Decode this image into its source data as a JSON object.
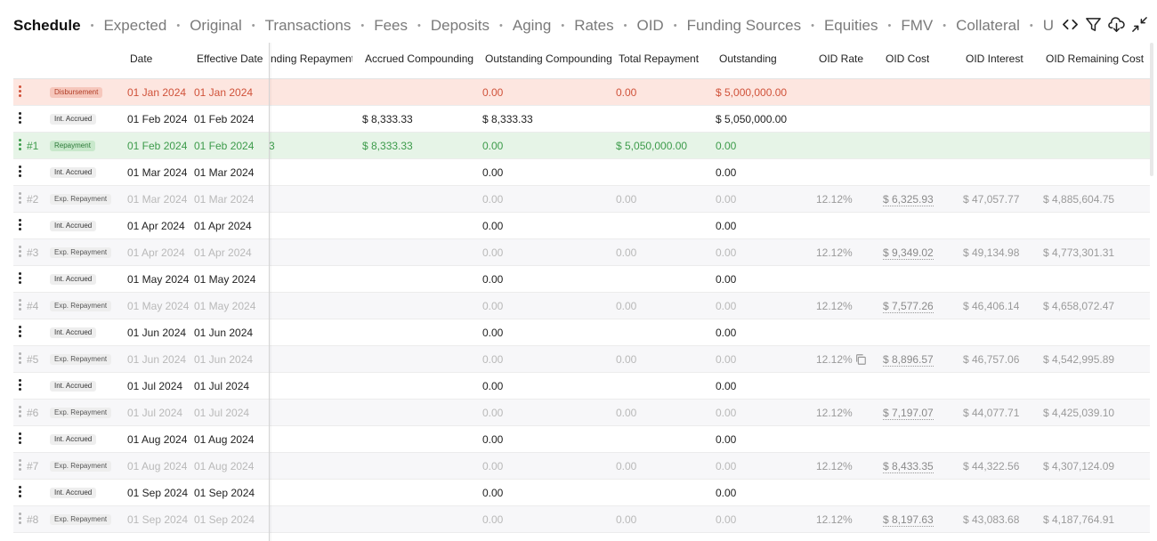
{
  "tabs": [
    {
      "label": "Schedule",
      "active": true
    },
    {
      "label": "Expected"
    },
    {
      "label": "Original"
    },
    {
      "label": "Transactions"
    },
    {
      "label": "Fees"
    },
    {
      "label": "Deposits"
    },
    {
      "label": "Aging"
    },
    {
      "label": "Rates"
    },
    {
      "label": "OID"
    },
    {
      "label": "Funding Sources"
    },
    {
      "label": "Equities"
    },
    {
      "label": "FMV"
    },
    {
      "label": "Collateral"
    },
    {
      "label": "U"
    }
  ],
  "separator": "•",
  "toolbar": {
    "icons": [
      "code-icon",
      "filter-icon",
      "cloud-download-icon",
      "collapse-icon"
    ]
  },
  "columns": {
    "date": "Date",
    "effective_date": "Effective Date",
    "funding_repayment": "nding Repayment",
    "accrued_compounding": "Accrued Compounding",
    "outstanding_compounding": "Outstanding Compounding",
    "total_repayment": "Total Repayment",
    "outstanding": "Outstanding",
    "oid_rate": "OID Rate",
    "oid_cost": "OID Cost",
    "oid_interest": "OID Interest",
    "oid_remaining_cost": "OID Remaining Cost"
  },
  "rows": [
    {
      "kind": "disb",
      "num": "",
      "badge": "Disbursement",
      "date": "01 Jan 2024",
      "eff": "01 Jan 2024",
      "fund": "",
      "accr": "",
      "outc": "0.00",
      "total": "0.00",
      "out": "$ 5,000,000.00",
      "rate": "",
      "cost": "",
      "int": "",
      "rem": ""
    },
    {
      "kind": "accr",
      "num": "",
      "badge": "Int. Accrued",
      "date": "01 Feb 2024",
      "eff": "01 Feb 2024",
      "fund": "",
      "accr": "$ 8,333.33",
      "outc": "$ 8,333.33",
      "total": "",
      "out": "$ 5,050,000.00",
      "rate": "",
      "cost": "",
      "int": "",
      "rem": ""
    },
    {
      "kind": "repay",
      "num": "#1",
      "badge": "Repayment",
      "date": "01 Feb 2024",
      "eff": "01 Feb 2024",
      "fund": "3",
      "accr": "$ 8,333.33",
      "outc": "0.00",
      "total": "$ 5,050,000.00",
      "out": "0.00",
      "rate": "",
      "cost": "",
      "int": "",
      "rem": ""
    },
    {
      "kind": "accr",
      "num": "",
      "badge": "Int. Accrued",
      "date": "01 Mar 2024",
      "eff": "01 Mar 2024",
      "fund": "",
      "accr": "",
      "outc": "0.00",
      "total": "",
      "out": "0.00",
      "rate": "",
      "cost": "",
      "int": "",
      "rem": ""
    },
    {
      "kind": "exp",
      "num": "#2",
      "badge": "Exp. Repayment",
      "date": "01 Mar 2024",
      "eff": "01 Mar 2024",
      "fund": "",
      "accr": "",
      "outc": "0.00",
      "total": "0.00",
      "out": "0.00",
      "rate": "12.12%",
      "cost": "$ 6,325.93",
      "int": "$ 47,057.77",
      "rem": "$ 4,885,604.75"
    },
    {
      "kind": "accr",
      "num": "",
      "badge": "Int. Accrued",
      "date": "01 Apr 2024",
      "eff": "01 Apr 2024",
      "fund": "",
      "accr": "",
      "outc": "0.00",
      "total": "",
      "out": "0.00",
      "rate": "",
      "cost": "",
      "int": "",
      "rem": ""
    },
    {
      "kind": "exp",
      "num": "#3",
      "badge": "Exp. Repayment",
      "date": "01 Apr 2024",
      "eff": "01 Apr 2024",
      "fund": "",
      "accr": "",
      "outc": "0.00",
      "total": "0.00",
      "out": "0.00",
      "rate": "12.12%",
      "cost": "$ 9,349.02",
      "int": "$ 49,134.98",
      "rem": "$ 4,773,301.31"
    },
    {
      "kind": "accr",
      "num": "",
      "badge": "Int. Accrued",
      "date": "01 May 2024",
      "eff": "01 May 2024",
      "fund": "",
      "accr": "",
      "outc": "0.00",
      "total": "",
      "out": "0.00",
      "rate": "",
      "cost": "",
      "int": "",
      "rem": ""
    },
    {
      "kind": "exp",
      "num": "#4",
      "badge": "Exp. Repayment",
      "date": "01 May 2024",
      "eff": "01 May 2024",
      "fund": "",
      "accr": "",
      "outc": "0.00",
      "total": "0.00",
      "out": "0.00",
      "rate": "12.12%",
      "cost": "$ 7,577.26",
      "int": "$ 46,406.14",
      "rem": "$ 4,658,072.47"
    },
    {
      "kind": "accr",
      "num": "",
      "badge": "Int. Accrued",
      "date": "01 Jun 2024",
      "eff": "01 Jun 2024",
      "fund": "",
      "accr": "",
      "outc": "0.00",
      "total": "",
      "out": "0.00",
      "rate": "",
      "cost": "",
      "int": "",
      "rem": ""
    },
    {
      "kind": "exp",
      "num": "#5",
      "badge": "Exp. Repayment",
      "date": "01 Jun 2024",
      "eff": "01 Jun 2024",
      "fund": "",
      "accr": "",
      "outc": "0.00",
      "total": "0.00",
      "out": "0.00",
      "rate": "12.12%",
      "cost": "$ 8,896.57",
      "int": "$ 46,757.06",
      "rem": "$ 4,542,995.89",
      "copy": true
    },
    {
      "kind": "accr",
      "num": "",
      "badge": "Int. Accrued",
      "date": "01 Jul 2024",
      "eff": "01 Jul 2024",
      "fund": "",
      "accr": "",
      "outc": "0.00",
      "total": "",
      "out": "0.00",
      "rate": "",
      "cost": "",
      "int": "",
      "rem": ""
    },
    {
      "kind": "exp",
      "num": "#6",
      "badge": "Exp. Repayment",
      "date": "01 Jul 2024",
      "eff": "01 Jul 2024",
      "fund": "",
      "accr": "",
      "outc": "0.00",
      "total": "0.00",
      "out": "0.00",
      "rate": "12.12%",
      "cost": "$ 7,197.07",
      "int": "$ 44,077.71",
      "rem": "$ 4,425,039.10"
    },
    {
      "kind": "accr",
      "num": "",
      "badge": "Int. Accrued",
      "date": "01 Aug 2024",
      "eff": "01 Aug 2024",
      "fund": "",
      "accr": "",
      "outc": "0.00",
      "total": "",
      "out": "0.00",
      "rate": "",
      "cost": "",
      "int": "",
      "rem": ""
    },
    {
      "kind": "exp",
      "num": "#7",
      "badge": "Exp. Repayment",
      "date": "01 Aug 2024",
      "eff": "01 Aug 2024",
      "fund": "",
      "accr": "",
      "outc": "0.00",
      "total": "0.00",
      "out": "0.00",
      "rate": "12.12%",
      "cost": "$ 8,433.35",
      "int": "$ 44,322.56",
      "rem": "$ 4,307,124.09"
    },
    {
      "kind": "accr",
      "num": "",
      "badge": "Int. Accrued",
      "date": "01 Sep 2024",
      "eff": "01 Sep 2024",
      "fund": "",
      "accr": "",
      "outc": "0.00",
      "total": "",
      "out": "0.00",
      "rate": "",
      "cost": "",
      "int": "",
      "rem": ""
    },
    {
      "kind": "exp",
      "num": "#8",
      "badge": "Exp. Repayment",
      "date": "01 Sep 2024",
      "eff": "01 Sep 2024",
      "fund": "",
      "accr": "",
      "outc": "0.00",
      "total": "0.00",
      "out": "0.00",
      "rate": "12.12%",
      "cost": "$ 8,197.63",
      "int": "$ 43,083.68",
      "rem": "$ 4,187,764.91"
    }
  ]
}
